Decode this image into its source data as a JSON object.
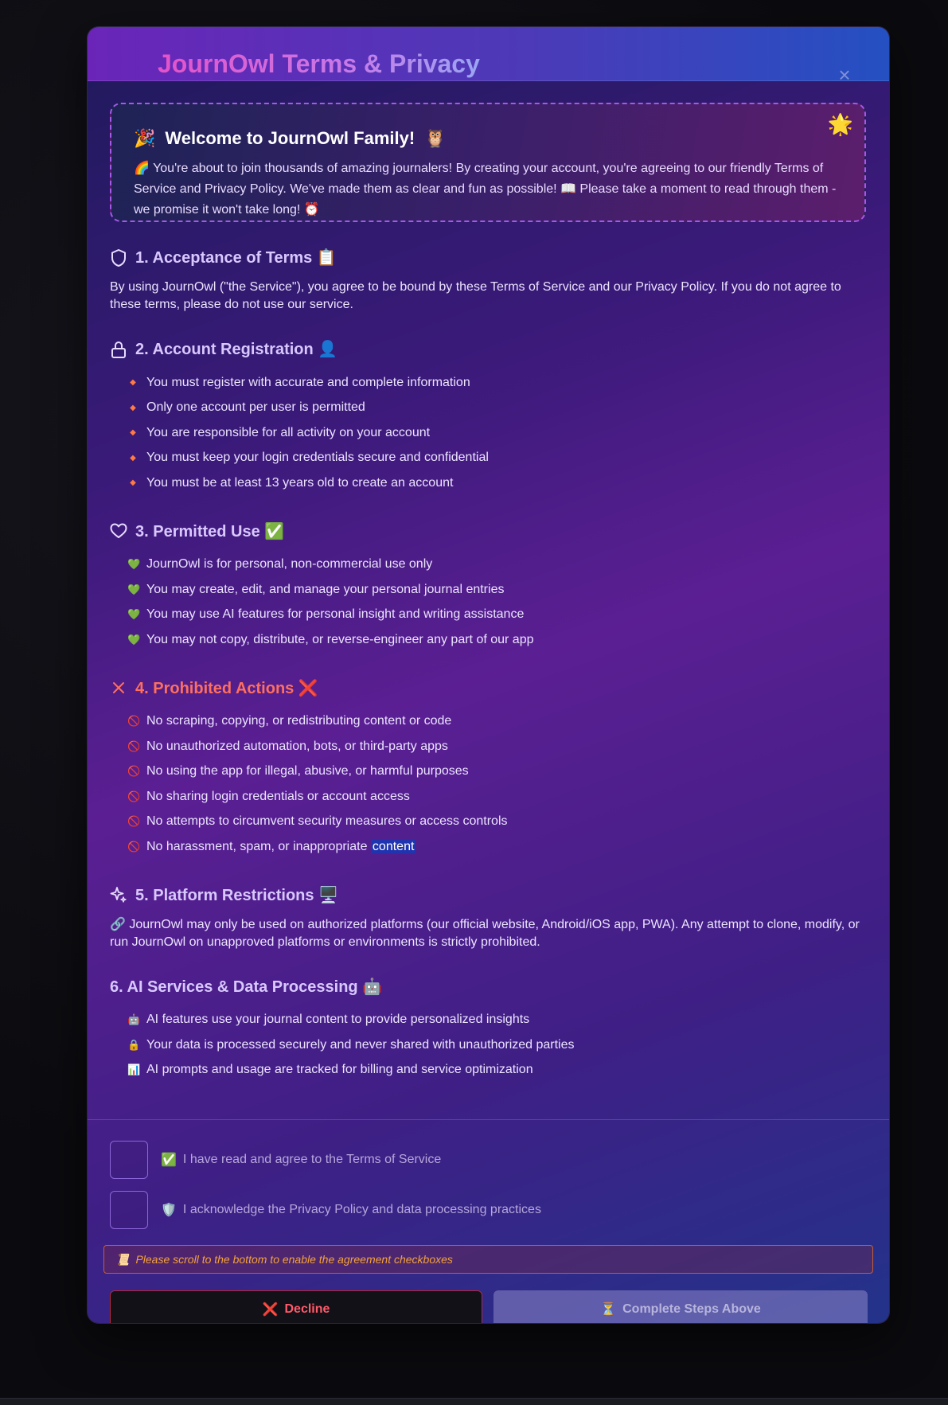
{
  "modal": {
    "title": "JournOwl Terms & Privacy",
    "close_icon": "close-icon"
  },
  "welcome": {
    "emoji_left": "🎉",
    "title": "Welcome to JournOwl Family!",
    "emoji_right": "🦉",
    "sparkle": "🌟",
    "text": "🌈 You're about to join thousands of amazing journalers! By creating your account, you're agreeing to our friendly Terms of Service and Privacy Policy. We've made them as clear and fun as possible! 📖 Please take a moment to read through them - we promise it won't take long! ⏰"
  },
  "sections": {
    "s1": {
      "title": "1. Acceptance of Terms 📋",
      "text": "By using JournOwl (\"the Service\"), you agree to be bound by these Terms of Service and our Privacy Policy. If you do not agree to these terms, please do not use our service."
    },
    "s2": {
      "title": "2. Account Registration 👤",
      "items": [
        "You must register with accurate and complete information",
        "Only one account per user is permitted",
        "You are responsible for all activity on your account",
        "You must keep your login credentials secure and confidential",
        "You must be at least 13 years old to create an account"
      ]
    },
    "s3": {
      "title": "3. Permitted Use ✅",
      "bullet": "💚",
      "items": [
        "JournOwl is for personal, non-commercial use only",
        "You may create, edit, and manage your personal journal entries",
        "You may use AI features for personal insight and writing assistance",
        "You may not copy, distribute, or reverse-engineer any part of our app"
      ]
    },
    "s4": {
      "title": "4. Prohibited Actions ❌",
      "bullet": "🚫",
      "items": [
        "No scraping, copying, or redistributing content or code",
        "No unauthorized automation, bots, or third-party apps",
        "No using the app for illegal, abusive, or harmful purposes",
        "No sharing login credentials or account access",
        "No attempts to circumvent security measures or access controls"
      ],
      "last_item_text": "No harassment, spam, or inappropriate ",
      "last_item_highlight": "content"
    },
    "s5": {
      "title": "5. Platform Restrictions 🖥️",
      "text": "🔗 JournOwl may only be used on authorized platforms (our official website, Android/iOS app, PWA). Any attempt to clone, modify, or run JournOwl on unapproved platforms or environments is strictly prohibited."
    },
    "s6": {
      "title": "6. AI Services & Data Processing 🤖",
      "items": [
        {
          "icon": "🤖",
          "text": "AI features use your journal content to provide personalized insights"
        },
        {
          "icon": "🔒",
          "text": "Your data is processed securely and never shared with unauthorized parties"
        },
        {
          "icon": "📊",
          "text": "AI prompts and usage are tracked for billing and service optimization"
        }
      ]
    }
  },
  "footer": {
    "checkbox_terms": {
      "emoji": "✅",
      "label": "I have read and agree to the Terms of Service"
    },
    "checkbox_privacy": {
      "emoji": "🛡️",
      "label": "I acknowledge the Privacy Policy and data processing practices"
    },
    "warning": {
      "emoji": "📜",
      "text": "Please scroll to the bottom to enable the agreement checkboxes"
    },
    "decline": {
      "emoji": "❌",
      "label": "Decline"
    },
    "complete": {
      "emoji": "⏳",
      "label": "Complete Steps Above"
    }
  }
}
